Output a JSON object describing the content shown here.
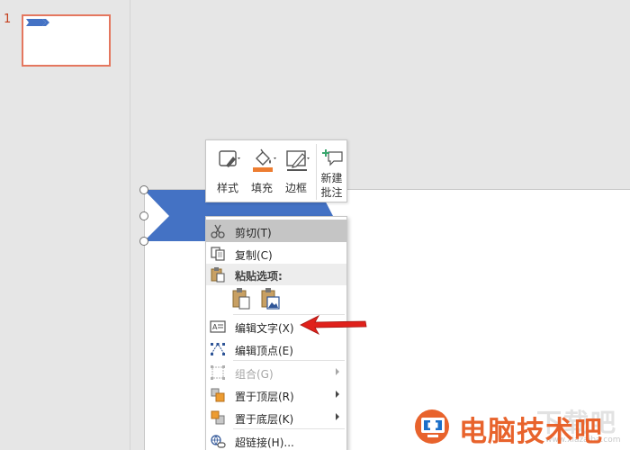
{
  "thumbnails": {
    "slide_number": "1"
  },
  "mini_toolbar": {
    "style_label": "样式",
    "fill_label": "填充",
    "outline_label": "边框",
    "new_comment_line1": "新建",
    "new_comment_line2": "批注",
    "fill_color": "#ed7d31"
  },
  "context_menu": {
    "cut": "剪切(T)",
    "copy": "复制(C)",
    "paste_options": "粘贴选项:",
    "edit_text": "编辑文字(X)",
    "edit_points": "编辑顶点(E)",
    "group": "组合(G)",
    "bring_to_front": "置于顶层(R)",
    "send_to_back": "置于底层(K)",
    "hyperlink": "超链接(H)..."
  },
  "watermark": {
    "text": "电脑技术吧",
    "ghost_text": "下载吧",
    "url": "www.xiazaiba.com"
  },
  "colors": {
    "shape_blue": "#4472c4",
    "annotation_red": "#e0201b",
    "thumb_border": "#e4775f",
    "watermark_orange": "#e8632c",
    "watermark_blue": "#1b6fc9"
  }
}
